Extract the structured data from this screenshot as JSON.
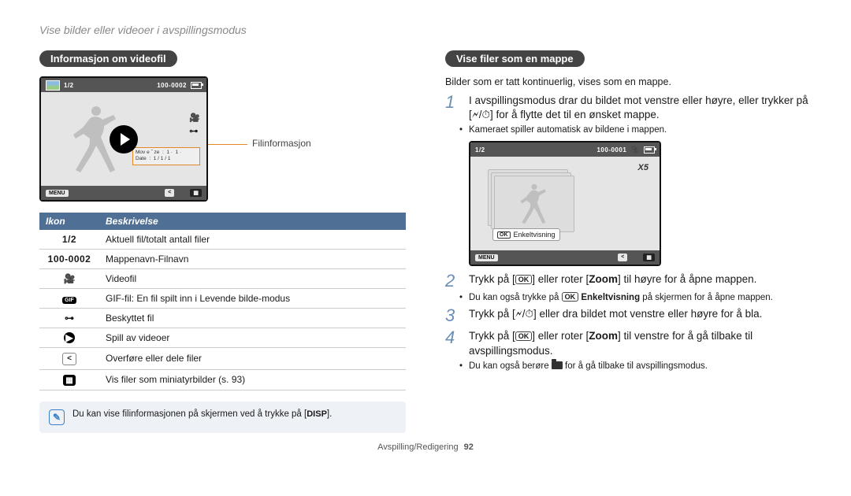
{
  "breadcrumb": "Vise bilder eller videoer i avspillingsmodus",
  "left": {
    "heading": "Informasjon om videofil",
    "screen": {
      "counter": "1/2",
      "file_id": "100-0002",
      "info_box_lines": "Mov e ˝ ze  :  1 ·  1 ·\nDate  :  1 / 1 / 1",
      "menu_label": "MENU"
    },
    "leader_label": "Filinformasjon",
    "table": {
      "col_icon": "Ikon",
      "col_desc": "Beskrivelse",
      "rows": [
        {
          "icon_text": "1/2",
          "icon_kind": "text",
          "desc": "Aktuell fil/totalt antall filer"
        },
        {
          "icon_text": "100-0002",
          "icon_kind": "text",
          "desc": "Mappenavn-Filnavn"
        },
        {
          "icon_text": "",
          "icon_kind": "movie",
          "desc": "Videofil"
        },
        {
          "icon_text": "GIF",
          "icon_kind": "gif",
          "desc": "GIF-fil: En fil spilt inn i Levende bilde-modus"
        },
        {
          "icon_text": "",
          "icon_kind": "key",
          "desc": "Beskyttet fil"
        },
        {
          "icon_text": "",
          "icon_kind": "play",
          "desc": "Spill av videoer"
        },
        {
          "icon_text": "",
          "icon_kind": "share",
          "desc": "Overføre eller dele filer"
        },
        {
          "icon_text": "",
          "icon_kind": "grid",
          "desc": "Vis filer som miniatyrbilder (s. 93)"
        }
      ]
    },
    "note_prefix": "Du kan vise filinformasjonen på skjermen ved å trykke på [",
    "note_key": "DISP",
    "note_suffix": "]."
  },
  "right": {
    "heading": "Vise filer som en mappe",
    "desc": "Bilder som er tatt kontinuerlig, vises som en mappe.",
    "screen": {
      "counter": "1/2",
      "file_id": "100-0001",
      "x5": "X5",
      "ok_label": "Enkeltvisning",
      "ok_key": "OK",
      "menu_label": "MENU"
    },
    "steps": [
      {
        "num": "1",
        "text": "I avspillingsmodus drar du bildet mot venstre eller høyre, eller trykker på [🗲/⏱] for å flytte det til en ønsket mappe.",
        "bullets": [
          "Kameraet spiller automatisk av bildene i mappen."
        ]
      },
      {
        "num": "2",
        "text_pre": "Trykk på [",
        "key": "OK",
        "text_mid": "] eller roter [",
        "zoom": "Zoom",
        "text_post": "] til høyre for å åpne mappen.",
        "bullets_html": true,
        "bullet_pre": "Du kan også trykke på ",
        "bullet_key": "OK",
        "bullet_bold": "Enkeltvisning",
        "bullet_post": " på skjermen for å åpne mappen."
      },
      {
        "num": "3",
        "text": "Trykk på [🗲/⏱] eller dra bildet mot venstre eller høyre for å bla."
      },
      {
        "num": "4",
        "text_pre": "Trykk på [",
        "key": "OK",
        "text_mid": "] eller roter [",
        "zoom": "Zoom",
        "text_post": "] til venstre for å gå tilbake til avspillingsmodus.",
        "bullets_folder": true,
        "bullet_pre": "Du kan også berøre ",
        "bullet_post": " for å gå tilbake til avspillingsmodus."
      }
    ]
  },
  "footer": {
    "section": "Avspilling/Redigering",
    "page": "92"
  }
}
